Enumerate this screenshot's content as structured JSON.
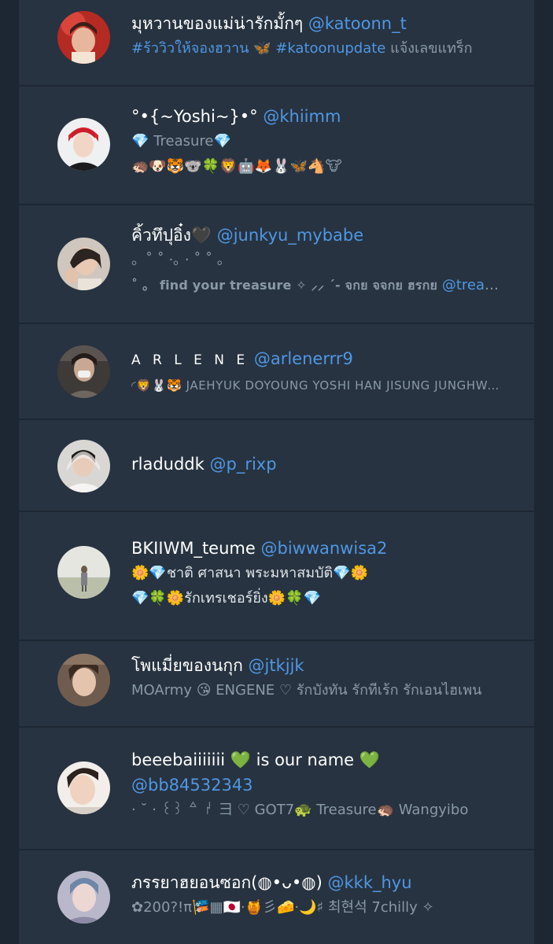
{
  "users": [
    {
      "name": "มุหวานของแม่น่ารักมั้กๆ",
      "handle": "@katoonn_t",
      "bio1_link": "#ร้ววิวให้จองฮวาน 🦋 #katoonupdate",
      "bio1_rest": " แจ้งเลขแทร็ก"
    },
    {
      "name": "°•{~Yoshi~}•°",
      "handle": "@khiimm",
      "bio1": "💎 Treasure💎",
      "bio2": "🦔🐶🐯🐨🍀🦁🤖🦊🐰🦋🐴🐮"
    },
    {
      "name": "คิ้วทึปุอิ๋ง🖤",
      "handle": "@junkyu_mybabe",
      "bio1": "。˚ ˚ ·｡ · ˚ ˚ 。",
      "bio2_text": "˚ 。 find your treasure ✧ ⸝⸝ ˊ- จกย จจกย ฮรกย ",
      "bio2_link": "@treasuremembers"
    },
    {
      "name": "A R L E N E",
      "handle": "@arlenerrr9",
      "bio1": "◜🦁🐰🐯 JAEHYUK DOYOUNG YOSHI HAN JISUNG JUNGHWAN"
    },
    {
      "name": "rladuddk",
      "handle": "@p_rixp"
    },
    {
      "name": "BKIIWM_teume",
      "handle": "@biwwanwisa2",
      "bio1": "🌼💎ชาติ ศาสนา พระมหาสมบัติ💎🌼",
      "bio2": "💎🍀🌼รักเทรเชอร์ยิ่ง🌼🍀💎"
    },
    {
      "name": "โพแมี่ยของนกุก",
      "handle": "@jtkjjk",
      "bio1": "MOArmy 😘 ENGENE ♡ รักบังทัน รักทีเร้ก รักเอนไฮเพน"
    },
    {
      "name": "beeebaiiiiiii 💚 is our name 💚",
      "handle": "@bb84532343",
      "bio1": "· ˘ · ꒰꒱ ꒫ ꒛ ⺕ ♡ GOT7🐢 Treasure🦔 Wangyibo"
    },
    {
      "name": "ภรรยาฮยอนซอก(◍•ᴗ•◍)",
      "handle": "@kkk_hyu",
      "bio1": "✿200?!π🎏▦🇯🇵·🍯彡🧀·🌙♯ 최현석 7chilly ✧"
    }
  ]
}
